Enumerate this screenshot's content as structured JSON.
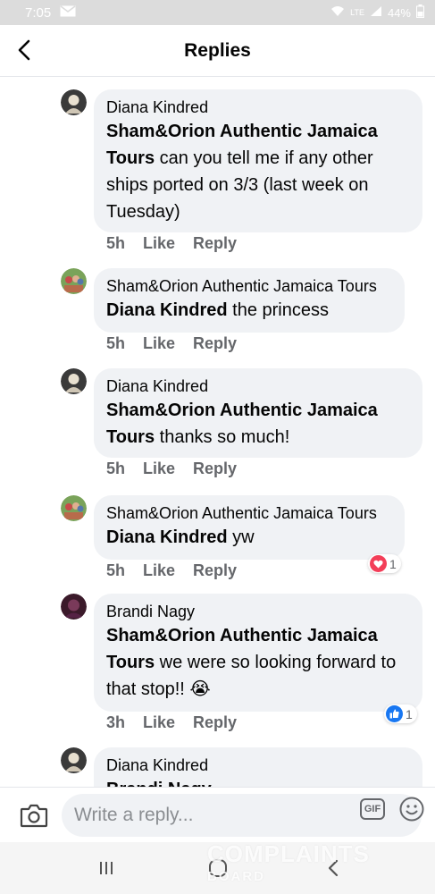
{
  "status_bar": {
    "time": "7:05",
    "battery": "44%",
    "network": "LTE"
  },
  "header": {
    "title": "Replies"
  },
  "replies": [
    {
      "author": "Diana Kindred",
      "mention": "Sham&Orion Authentic Jamaica Tours",
      "text": " can you tell me if any other ships ported on 3/3 (last week on Tuesday)",
      "time": "5h",
      "like": "Like",
      "reply": "Reply"
    },
    {
      "author": "Sham&Orion Authentic Jamaica Tours",
      "mention": "Diana Kindred",
      "text": " the princess",
      "time": "5h",
      "like": "Like",
      "reply": "Reply"
    },
    {
      "author": "Diana Kindred",
      "mention": "Sham&Orion Authentic Jamaica Tours",
      "text": " thanks so much!",
      "time": "5h",
      "like": "Like",
      "reply": "Reply"
    },
    {
      "author": "Sham&Orion Authentic Jamaica Tours",
      "mention": "Diana Kindred",
      "text": " yw",
      "time": "5h",
      "like": "Like",
      "reply": "Reply",
      "reaction_count": "1",
      "reaction_type": "love"
    },
    {
      "author": "Brandi Nagy",
      "mention": "Sham&Orion Authentic Jamaica Tours",
      "text": " we were so looking forward to that stop!! 😭",
      "time": "3h",
      "like": "Like",
      "reply": "Reply",
      "reaction_count": "1",
      "reaction_type": "like"
    },
    {
      "author": "Diana Kindred",
      "mention": "Brandi Nagy",
      "text": "",
      "time": "",
      "like": "",
      "reply": ""
    }
  ],
  "composer": {
    "placeholder": "Write a reply...",
    "gif_label": "GIF"
  },
  "watermark": {
    "line1": "COMPLAINTS",
    "line2": "BOARD"
  },
  "colors": {
    "love": "#f33e58",
    "like": "#1877f2",
    "bubble": "#f0f2f5",
    "meta": "#65676b"
  }
}
